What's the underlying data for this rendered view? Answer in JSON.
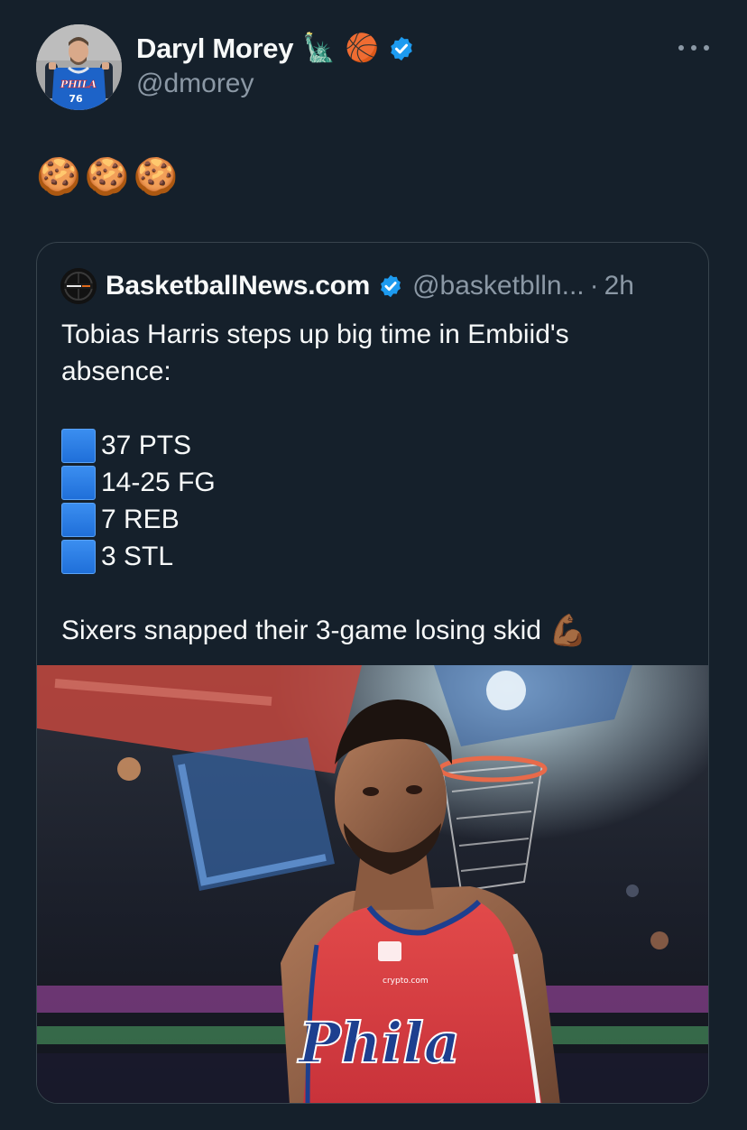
{
  "author": {
    "display_name": "Daryl Morey",
    "name_emojis": [
      "🗽",
      "🏀"
    ],
    "handle": "@dmorey",
    "avatar_jersey_text": "PHILA",
    "avatar_jersey_number": "76"
  },
  "tweet_text": "🍪🍪🍪",
  "quoted": {
    "display_name": "BasketballNews.com",
    "handle": "@basketblln...",
    "separator": "·",
    "time": "2h",
    "headline_line1": "Tobias Harris steps up big time in Embiid's",
    "headline_line2": "absence:",
    "stats": [
      "37 PTS",
      "14-25 FG",
      "7 REB",
      "3 STL"
    ],
    "footer": "Sixers snapped their 3-game losing skid",
    "footer_emoji": "💪🏾",
    "media": {
      "jersey_text": "Phila",
      "sponsor_text": "crypto.com"
    }
  },
  "icons": {
    "verified": "verified-badge-icon",
    "more": "more-options-icon",
    "stat_bullet": "blue-square-icon"
  },
  "colors": {
    "background": "#15202b",
    "text": "#f7f9f9",
    "secondary": "#8b98a5",
    "verified": "#1d9bf0",
    "border": "#38444d"
  }
}
